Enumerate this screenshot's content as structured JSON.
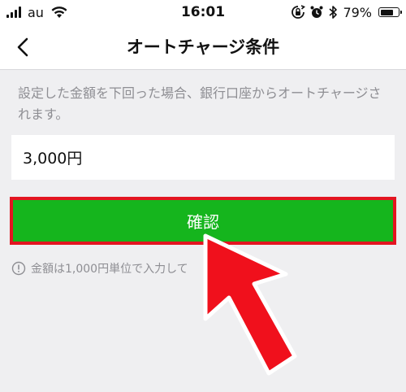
{
  "status_bar": {
    "carrier": "au",
    "time": "16:01",
    "battery_percent": "79%",
    "battery_level": 0.79
  },
  "nav": {
    "title": "オートチャージ条件"
  },
  "content": {
    "description": "設定した金額を下回った場合、銀行口座からオートチャージされます。",
    "amount_value": "3,000円",
    "confirm_label": "確認",
    "note": "金額は1,000円単位で入力して"
  },
  "colors": {
    "confirm_bg": "#15b51d",
    "highlight_border": "#e31521",
    "arrow": "#f0101c"
  },
  "icons": {
    "back": "chevron-left-icon",
    "info": "info-circle-icon",
    "wifi": "wifi-icon",
    "signal": "signal-bars-icon",
    "rotation_lock": "rotation-lock-icon",
    "alarm": "alarm-clock-icon",
    "bluetooth": "bluetooth-icon",
    "battery": "battery-icon"
  }
}
